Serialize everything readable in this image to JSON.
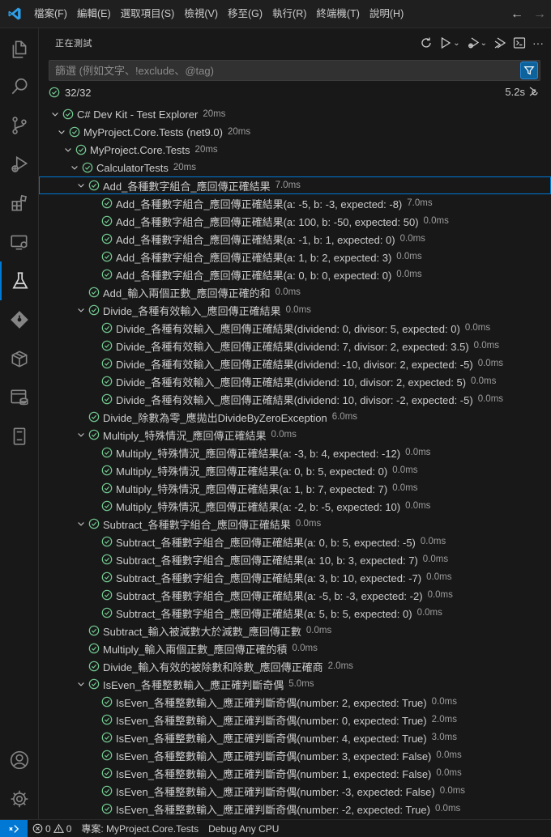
{
  "menu": [
    "檔案(F)",
    "編輯(E)",
    "選取項目(S)",
    "檢視(V)",
    "移至(G)",
    "執行(R)",
    "終端機(T)",
    "說明(H)"
  ],
  "nav": {
    "back": "←",
    "forward": "→"
  },
  "panel": {
    "title": "正在測試",
    "filter_placeholder": "篩選 (例如文字、!exclude、@tag)",
    "filter_value": "",
    "summary_count": "32/32",
    "summary_time": "5.2s"
  },
  "tree": [
    {
      "label": "C# Dev Kit - Test Explorer",
      "dur": "20ms",
      "level": 0,
      "twistie": true
    },
    {
      "label": "MyProject.Core.Tests (net9.0)",
      "dur": "20ms",
      "level": 1,
      "twistie": true
    },
    {
      "label": "MyProject.Core.Tests",
      "dur": "20ms",
      "level": 2,
      "twistie": true
    },
    {
      "label": "CalculatorTests",
      "dur": "20ms",
      "level": 3,
      "twistie": true
    },
    {
      "label": "Add_各種數字組合_應回傳正確結果",
      "dur": "7.0ms",
      "level": 4,
      "twistie": true,
      "selected": true
    },
    {
      "label": "Add_各種數字組合_應回傳正確結果(a: -5, b: -3, expected: -8)",
      "dur": "7.0ms",
      "level": 5
    },
    {
      "label": "Add_各種數字組合_應回傳正確結果(a: 100, b: -50, expected: 50)",
      "dur": "0.0ms",
      "level": 5
    },
    {
      "label": "Add_各種數字組合_應回傳正確結果(a: -1, b: 1, expected: 0)",
      "dur": "0.0ms",
      "level": 5
    },
    {
      "label": "Add_各種數字組合_應回傳正確結果(a: 1, b: 2, expected: 3)",
      "dur": "0.0ms",
      "level": 5
    },
    {
      "label": "Add_各種數字組合_應回傳正確結果(a: 0, b: 0, expected: 0)",
      "dur": "0.0ms",
      "level": 5
    },
    {
      "label": "Add_輸入兩個正數_應回傳正確的和",
      "dur": "0.0ms",
      "level": 4
    },
    {
      "label": "Divide_各種有效輸入_應回傳正確結果",
      "dur": "0.0ms",
      "level": 4,
      "twistie": true
    },
    {
      "label": "Divide_各種有效輸入_應回傳正確結果(dividend: 0, divisor: 5, expected: 0)",
      "dur": "0.0ms",
      "level": 5
    },
    {
      "label": "Divide_各種有效輸入_應回傳正確結果(dividend: 7, divisor: 2, expected: 3.5)",
      "dur": "0.0ms",
      "level": 5
    },
    {
      "label": "Divide_各種有效輸入_應回傳正確結果(dividend: -10, divisor: 2, expected: -5)",
      "dur": "0.0ms",
      "level": 5
    },
    {
      "label": "Divide_各種有效輸入_應回傳正確結果(dividend: 10, divisor: 2, expected: 5)",
      "dur": "0.0ms",
      "level": 5
    },
    {
      "label": "Divide_各種有效輸入_應回傳正確結果(dividend: 10, divisor: -2, expected: -5)",
      "dur": "0.0ms",
      "level": 5
    },
    {
      "label": "Divide_除數為零_應拋出DivideByZeroException",
      "dur": "6.0ms",
      "level": 4
    },
    {
      "label": "Multiply_特殊情況_應回傳正確結果",
      "dur": "0.0ms",
      "level": 4,
      "twistie": true
    },
    {
      "label": "Multiply_特殊情況_應回傳正確結果(a: -3, b: 4, expected: -12)",
      "dur": "0.0ms",
      "level": 5
    },
    {
      "label": "Multiply_特殊情況_應回傳正確結果(a: 0, b: 5, expected: 0)",
      "dur": "0.0ms",
      "level": 5
    },
    {
      "label": "Multiply_特殊情況_應回傳正確結果(a: 1, b: 7, expected: 7)",
      "dur": "0.0ms",
      "level": 5
    },
    {
      "label": "Multiply_特殊情況_應回傳正確結果(a: -2, b: -5, expected: 10)",
      "dur": "0.0ms",
      "level": 5
    },
    {
      "label": "Subtract_各種數字組合_應回傳正確結果",
      "dur": "0.0ms",
      "level": 4,
      "twistie": true
    },
    {
      "label": "Subtract_各種數字組合_應回傳正確結果(a: 0, b: 5, expected: -5)",
      "dur": "0.0ms",
      "level": 5
    },
    {
      "label": "Subtract_各種數字組合_應回傳正確結果(a: 10, b: 3, expected: 7)",
      "dur": "0.0ms",
      "level": 5
    },
    {
      "label": "Subtract_各種數字組合_應回傳正確結果(a: 3, b: 10, expected: -7)",
      "dur": "0.0ms",
      "level": 5
    },
    {
      "label": "Subtract_各種數字組合_應回傳正確結果(a: -5, b: -3, expected: -2)",
      "dur": "0.0ms",
      "level": 5
    },
    {
      "label": "Subtract_各種數字組合_應回傳正確結果(a: 5, b: 5, expected: 0)",
      "dur": "0.0ms",
      "level": 5
    },
    {
      "label": "Subtract_輸入被減數大於減數_應回傳正數",
      "dur": "0.0ms",
      "level": 4
    },
    {
      "label": "Multiply_輸入兩個正數_應回傳正確的積",
      "dur": "0.0ms",
      "level": 4
    },
    {
      "label": "Divide_輸入有效的被除數和除數_應回傳正確商",
      "dur": "2.0ms",
      "level": 4
    },
    {
      "label": "IsEven_各種整數輸入_應正確判斷奇偶",
      "dur": "5.0ms",
      "level": 4,
      "twistie": true
    },
    {
      "label": "IsEven_各種整數輸入_應正確判斷奇偶(number: 2, expected: True)",
      "dur": "0.0ms",
      "level": 5
    },
    {
      "label": "IsEven_各種整數輸入_應正確判斷奇偶(number: 0, expected: True)",
      "dur": "2.0ms",
      "level": 5
    },
    {
      "label": "IsEven_各種整數輸入_應正確判斷奇偶(number: 4, expected: True)",
      "dur": "3.0ms",
      "level": 5
    },
    {
      "label": "IsEven_各種整數輸入_應正確判斷奇偶(number: 3, expected: False)",
      "dur": "0.0ms",
      "level": 5
    },
    {
      "label": "IsEven_各種整數輸入_應正確判斷奇偶(number: 1, expected: False)",
      "dur": "0.0ms",
      "level": 5
    },
    {
      "label": "IsEven_各種整數輸入_應正確判斷奇偶(number: -3, expected: False)",
      "dur": "0.0ms",
      "level": 5
    },
    {
      "label": "IsEven_各種整數輸入_應正確判斷奇偶(number: -2, expected: True)",
      "dur": "0.0ms",
      "level": 5
    }
  ],
  "statusbar": {
    "remote_icon": "remote-icon",
    "errors": "0",
    "warnings": "0",
    "project": "專案: MyProject.Core.Tests",
    "config": "Debug Any CPU"
  },
  "colors": {
    "accent": "#0078d4",
    "pass": "#73c991",
    "filter_btn": "#0e639c"
  }
}
